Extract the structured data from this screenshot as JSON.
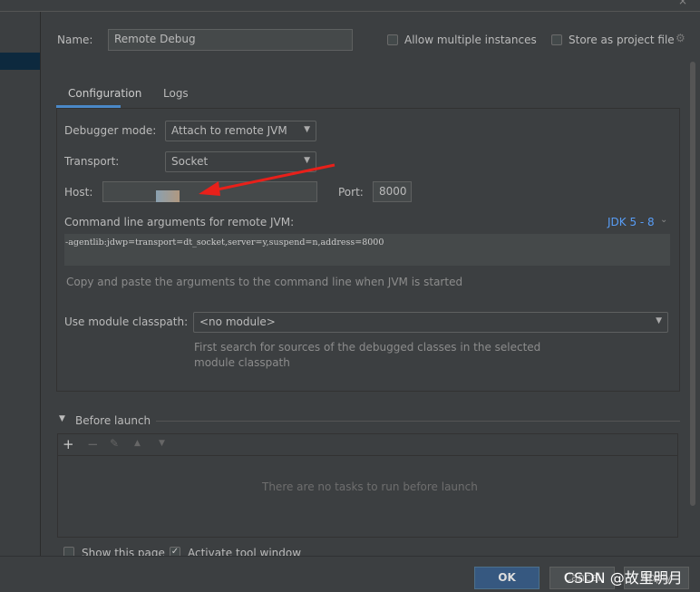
{
  "header": {
    "name_label": "Name:",
    "name_value": "Remote Debug",
    "allow_multiple": "Allow multiple instances",
    "store_project": "Store as project file"
  },
  "tabs": [
    {
      "label": "Configuration",
      "active": true
    },
    {
      "label": "Logs",
      "active": false
    }
  ],
  "config": {
    "debugger_mode_label": "Debugger mode:",
    "debugger_mode_value": "Attach to remote JVM",
    "transport_label": "Transport:",
    "transport_value": "Socket",
    "host_label": "Host:",
    "host_value": "",
    "port_label": "Port:",
    "port_value": "8000",
    "cmd_label": "Command line arguments for remote JVM:",
    "jdk_selector": "JDK 5 - 8",
    "cmd_value": "-agentlib:jdwp=transport=dt_socket,server=y,suspend=n,address=8000",
    "cmd_hint": "Copy and paste the arguments to the command line when JVM is started",
    "module_label": "Use module classpath:",
    "module_value": "<no module>",
    "module_hint_1": "First search for sources of the debugged classes in the selected",
    "module_hint_2": "module classpath"
  },
  "before_launch": {
    "title": "Before launch",
    "empty": "There are no tasks to run before launch",
    "show_page": "Show this page",
    "activate_tool": "Activate tool window"
  },
  "buttons": {
    "ok": "OK",
    "cancel": "Cancel",
    "apply": "Apply"
  },
  "watermark": "CSDN @故里明月",
  "colors": {
    "accent": "#589df6",
    "ok_button": "#365880",
    "arrow": "#e8201a"
  }
}
